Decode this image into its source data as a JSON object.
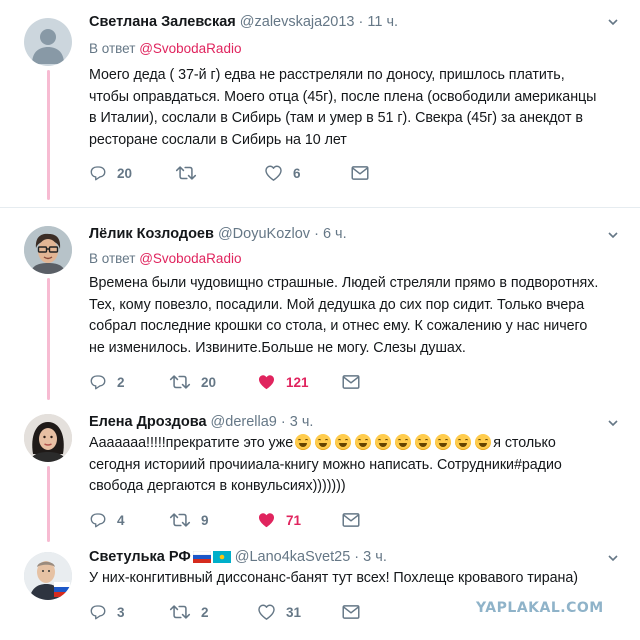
{
  "reply_prefix": "В ответ",
  "tweets": [
    {
      "name": "Светлана Залевская",
      "handle": "@zalevskaja2013",
      "time": "11 ч.",
      "reply_to": "@SvobodaRadio",
      "text": "Моего деда ( 37-й г) едва не расстреляли по доносу, пришлось платить,\nчтобы оправдаться. Моего отца (45г), после плена (освободили американцы\nв Италии), сослали в Сибирь (там и умер в 51 г). Свекра (45г) за анекдот в\nресторане сослали в Сибирь на 10 лет",
      "replies": "20",
      "retweets": "",
      "likes": "6",
      "liked": false
    },
    {
      "name": "Лёлик Козлодоев",
      "handle": "@DoyuKozlov",
      "time": "6 ч.",
      "reply_to": "@SvobodaRadio",
      "text": "Времена были чудовищно страшные. Людей стреляли прямо в подворотнях.\nТех, кому повезло, посадили. Мой дедушка до сих пор сидит. Только вчера\nсобрал последние крошки со стола, и отнес ему. К сожалению у нас ничего\nне изменилось. Извините.Больше не могу. Слезы душах.",
      "replies": "2",
      "retweets": "20",
      "likes": "121",
      "liked": true
    },
    {
      "name": "Елена Дроздова",
      "handle": "@derella9",
      "time": "3 ч.",
      "text_start": "Ааааааа!!!!!прекратите это уже",
      "text_end": "я столько",
      "text_rest": "сегодня историий прочииала-книгу можно написать. Сотрудники#радио\nсвобода дергаются в конвульсиях)))))))",
      "emoji_count": 10,
      "replies": "4",
      "retweets": "9",
      "likes": "71",
      "liked": true
    },
    {
      "name": "Светулька РФ",
      "handle": "@Lano4kaSvet25",
      "time": "3 ч.",
      "text": "У них-конгитивный диссонанс-банят тут всех! Похлеще кровавого тирана)",
      "replies": "3",
      "retweets": "2",
      "likes": "31",
      "liked": false
    }
  ],
  "watermark": "YAPLAKAL.COM",
  "colors": {
    "accent": "#e0245e",
    "muted": "#657786",
    "thread_line": "#f7bbd2",
    "divider": "#e6ecf0"
  },
  "icons": [
    "default-avatar-icon",
    "reply-icon",
    "retweet-icon",
    "like-icon",
    "heart-filled-icon",
    "message-icon",
    "chevron-down-icon",
    "russia-flag-icon",
    "kazakhstan-flag-icon",
    "laughing-emoji-icon"
  ]
}
